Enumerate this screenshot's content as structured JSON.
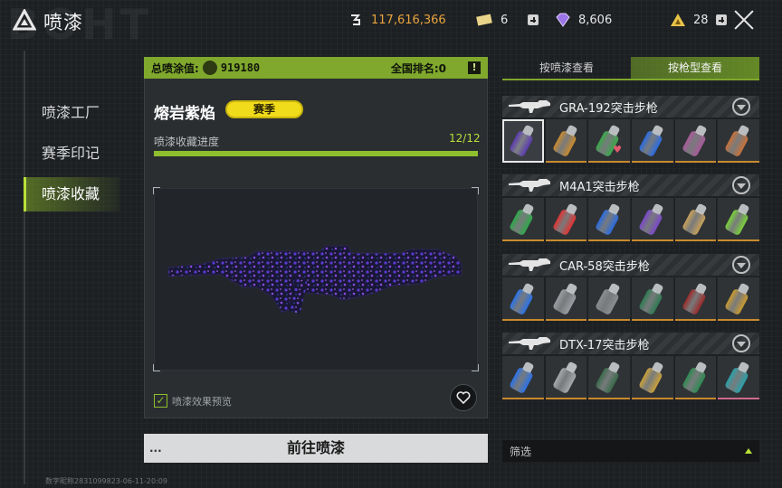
{
  "app": {
    "title": "喷漆",
    "watermark": "BOHT"
  },
  "currencies": {
    "coins": "117,616,366",
    "tickets": "6",
    "gems": "8,606",
    "gold": "28"
  },
  "sidebar": {
    "items": [
      {
        "label": "喷漆工厂",
        "active": false
      },
      {
        "label": "赛季印记",
        "active": false
      },
      {
        "label": "喷漆收藏",
        "active": true
      }
    ]
  },
  "stats": {
    "total_label": "总喷涂值:",
    "total_value": "919180",
    "rank": "全国排名:0",
    "info_glyph": "!"
  },
  "skin": {
    "name": "熔岩紫焰",
    "badge": "赛季",
    "progress_label": "喷漆收藏进度",
    "progress_text": "12/12",
    "progress_fraction": 1.0,
    "effect_label": "喷漆效果预览",
    "effect_checked": true,
    "favorite_icon": "heart-icon"
  },
  "actions": {
    "goto_label": "前往喷漆",
    "goto_dots": "..."
  },
  "tabs": [
    {
      "label": "按喷漆查看",
      "active": false
    },
    {
      "label": "按枪型查看",
      "active": true
    }
  ],
  "guns": [
    {
      "name": "GRA-192突击步枪",
      "cans": [
        {
          "color": "#5b3ab0",
          "selected": true,
          "fav": false
        },
        {
          "color": "#c98a2e",
          "selected": false,
          "fav": false
        },
        {
          "color": "#3aa84a",
          "selected": false,
          "fav": true
        },
        {
          "color": "#2a6be0",
          "selected": false,
          "fav": false
        },
        {
          "color": "#a85a9a",
          "selected": false,
          "fav": false
        },
        {
          "color": "#c8713a",
          "selected": false,
          "fav": false
        }
      ]
    },
    {
      "name": "M4A1突击步枪",
      "cans": [
        {
          "color": "#2fa84a",
          "selected": false,
          "fav": false
        },
        {
          "color": "#e03434",
          "selected": false,
          "fav": false
        },
        {
          "color": "#2a6be0",
          "selected": false,
          "fav": false
        },
        {
          "color": "#7a48c8",
          "selected": false,
          "fav": false
        },
        {
          "color": "#c9a15a",
          "selected": false,
          "fav": false
        },
        {
          "color": "#7ad03a",
          "selected": false,
          "fav": false
        }
      ]
    },
    {
      "name": "CAR-58突击步枪",
      "cans": [
        {
          "color": "#2a72e8",
          "selected": false,
          "fav": false
        },
        {
          "color": "#9a9ea2",
          "selected": false,
          "fav": false
        },
        {
          "color": "#8a8e91",
          "selected": false,
          "fav": false
        },
        {
          "color": "#2e7a52",
          "selected": false,
          "fav": false
        },
        {
          "color": "#9a2a2a",
          "selected": false,
          "fav": false
        },
        {
          "color": "#c99a2e",
          "selected": false,
          "fav": false
        }
      ]
    },
    {
      "name": "DTX-17突击步枪",
      "cans": [
        {
          "color": "#2a72e8",
          "selected": false,
          "fav": false
        },
        {
          "color": "#a6aaad",
          "selected": false,
          "fav": false
        },
        {
          "color": "#3a6a4a",
          "selected": false,
          "fav": false
        },
        {
          "color": "#c9a13a",
          "selected": false,
          "fav": false
        },
        {
          "color": "#2e8a52",
          "selected": false,
          "fav": false
        },
        {
          "color": "#2aa0a8",
          "selected": false,
          "fav": false,
          "pink_bar": true
        }
      ]
    }
  ],
  "filter": {
    "label": "筛选"
  },
  "footer": {
    "id_text": "数字昵称2831099823-06-11-20:09"
  },
  "colors": {
    "accent": "#7fa82d",
    "accent_bright": "#b8e03a",
    "coin_text": "#e8a33c",
    "badge": "#f0dc1a"
  }
}
